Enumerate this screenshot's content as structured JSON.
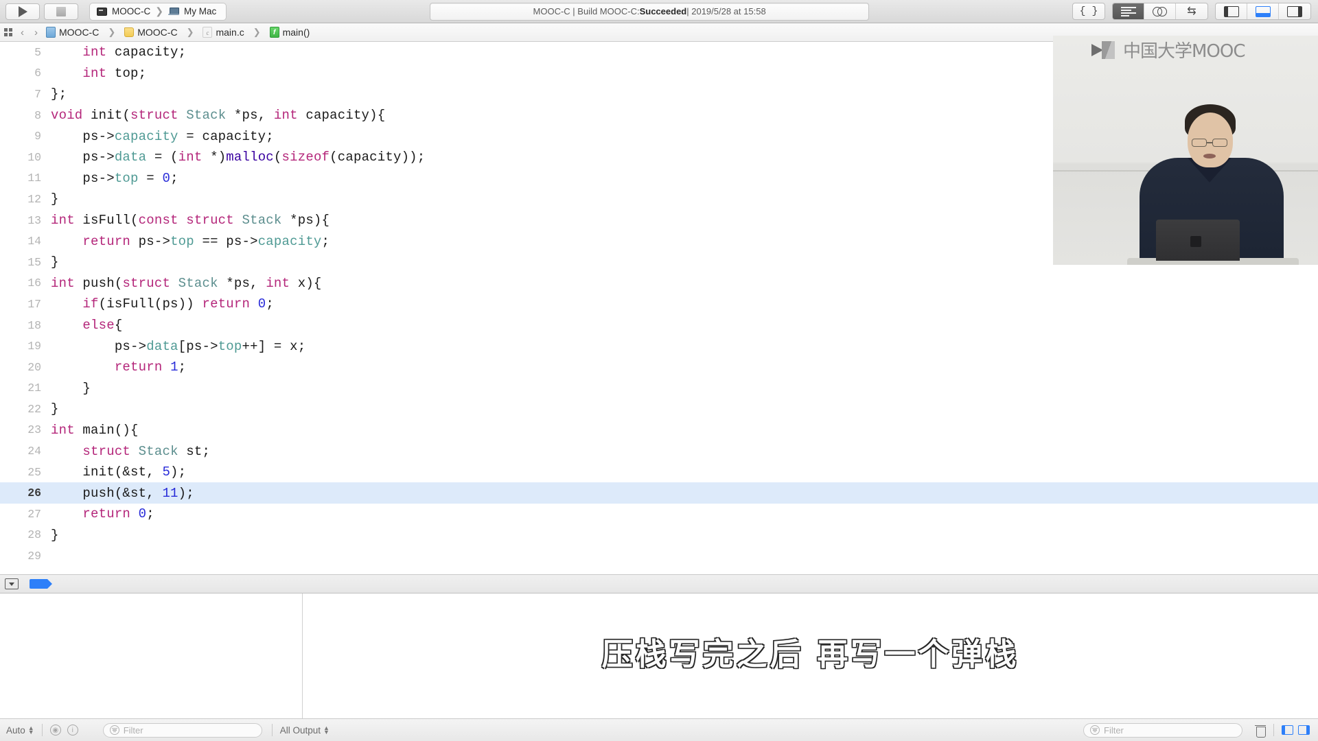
{
  "toolbar": {
    "run_button_label": "Run",
    "stop_button_label": "Stop",
    "scheme": {
      "target": "MOOC-C",
      "destination": "My Mac"
    },
    "status_prefix": "MOOC-C | Build MOOC-C: ",
    "status_result": "Succeeded",
    "status_suffix": " | 2019/5/28 at 15:58",
    "editor_modes": [
      "standard-editor",
      "assistant-editor",
      "version-editor"
    ],
    "braces_label": "{ }",
    "panel_toggles": [
      "navigator-toggle",
      "debug-area-toggle",
      "utilities-toggle"
    ]
  },
  "jumpbar": {
    "grid_label": "related-items",
    "back_label": "‹",
    "forward_label": "›",
    "crumbs": [
      {
        "icon": "project-icon",
        "label": "MOOC-C"
      },
      {
        "icon": "folder-icon",
        "label": "MOOC-C"
      },
      {
        "icon": "c-file-icon",
        "label": "main.c",
        "glyph": "c"
      },
      {
        "icon": "function-icon",
        "label": "main()",
        "glyph": "f"
      }
    ]
  },
  "editor": {
    "first_visible_line": 5,
    "current_line": 26,
    "language": "C",
    "lines": [
      {
        "n": 5,
        "tokens": [
          {
            "t": "    ",
            "c": "pl"
          },
          {
            "t": "int",
            "c": "kw"
          },
          {
            "t": " capacity;",
            "c": "pl"
          }
        ]
      },
      {
        "n": 6,
        "tokens": [
          {
            "t": "    ",
            "c": "pl"
          },
          {
            "t": "int",
            "c": "kw"
          },
          {
            "t": " top;",
            "c": "pl"
          }
        ]
      },
      {
        "n": 7,
        "tokens": [
          {
            "t": "};",
            "c": "pl"
          }
        ]
      },
      {
        "n": 8,
        "tokens": [
          {
            "t": "void",
            "c": "kw"
          },
          {
            "t": " init(",
            "c": "pl"
          },
          {
            "t": "struct",
            "c": "kw"
          },
          {
            "t": " ",
            "c": "pl"
          },
          {
            "t": "Stack",
            "c": "typ"
          },
          {
            "t": " *ps, ",
            "c": "pl"
          },
          {
            "t": "int",
            "c": "kw"
          },
          {
            "t": " capacity){",
            "c": "pl"
          }
        ]
      },
      {
        "n": 9,
        "tokens": [
          {
            "t": "    ps->",
            "c": "pl"
          },
          {
            "t": "capacity",
            "c": "mem"
          },
          {
            "t": " = capacity;",
            "c": "pl"
          }
        ]
      },
      {
        "n": 10,
        "tokens": [
          {
            "t": "    ps->",
            "c": "pl"
          },
          {
            "t": "data",
            "c": "mem"
          },
          {
            "t": " = (",
            "c": "pl"
          },
          {
            "t": "int",
            "c": "kw"
          },
          {
            "t": " *)",
            "c": "pl"
          },
          {
            "t": "malloc",
            "c": "fn"
          },
          {
            "t": "(",
            "c": "pl"
          },
          {
            "t": "sizeof",
            "c": "kw"
          },
          {
            "t": "(capacity));",
            "c": "pl"
          }
        ]
      },
      {
        "n": 11,
        "tokens": [
          {
            "t": "    ps->",
            "c": "pl"
          },
          {
            "t": "top",
            "c": "mem"
          },
          {
            "t": " = ",
            "c": "pl"
          },
          {
            "t": "0",
            "c": "num"
          },
          {
            "t": ";",
            "c": "pl"
          }
        ]
      },
      {
        "n": 12,
        "tokens": [
          {
            "t": "}",
            "c": "pl"
          }
        ]
      },
      {
        "n": 13,
        "tokens": [
          {
            "t": "int",
            "c": "kw"
          },
          {
            "t": " isFull(",
            "c": "pl"
          },
          {
            "t": "const",
            "c": "kw"
          },
          {
            "t": " ",
            "c": "pl"
          },
          {
            "t": "struct",
            "c": "kw"
          },
          {
            "t": " ",
            "c": "pl"
          },
          {
            "t": "Stack",
            "c": "typ"
          },
          {
            "t": " *ps){",
            "c": "pl"
          }
        ]
      },
      {
        "n": 14,
        "tokens": [
          {
            "t": "    ",
            "c": "pl"
          },
          {
            "t": "return",
            "c": "kw"
          },
          {
            "t": " ps->",
            "c": "pl"
          },
          {
            "t": "top",
            "c": "mem"
          },
          {
            "t": " == ps->",
            "c": "pl"
          },
          {
            "t": "capacity",
            "c": "mem"
          },
          {
            "t": ";",
            "c": "pl"
          }
        ]
      },
      {
        "n": 15,
        "tokens": [
          {
            "t": "}",
            "c": "pl"
          }
        ]
      },
      {
        "n": 16,
        "tokens": [
          {
            "t": "int",
            "c": "kw"
          },
          {
            "t": " push(",
            "c": "pl"
          },
          {
            "t": "struct",
            "c": "kw"
          },
          {
            "t": " ",
            "c": "pl"
          },
          {
            "t": "Stack",
            "c": "typ"
          },
          {
            "t": " *ps, ",
            "c": "pl"
          },
          {
            "t": "int",
            "c": "kw"
          },
          {
            "t": " x){",
            "c": "pl"
          }
        ]
      },
      {
        "n": 17,
        "tokens": [
          {
            "t": "    ",
            "c": "pl"
          },
          {
            "t": "if",
            "c": "kw"
          },
          {
            "t": "(isFull(ps)) ",
            "c": "pl"
          },
          {
            "t": "return",
            "c": "kw"
          },
          {
            "t": " ",
            "c": "pl"
          },
          {
            "t": "0",
            "c": "num"
          },
          {
            "t": ";",
            "c": "pl"
          }
        ]
      },
      {
        "n": 18,
        "tokens": [
          {
            "t": "    ",
            "c": "pl"
          },
          {
            "t": "else",
            "c": "kw"
          },
          {
            "t": "{",
            "c": "pl"
          }
        ]
      },
      {
        "n": 19,
        "tokens": [
          {
            "t": "        ps->",
            "c": "pl"
          },
          {
            "t": "data",
            "c": "mem"
          },
          {
            "t": "[ps->",
            "c": "pl"
          },
          {
            "t": "top",
            "c": "mem"
          },
          {
            "t": "++] = x;",
            "c": "pl"
          }
        ]
      },
      {
        "n": 20,
        "tokens": [
          {
            "t": "        ",
            "c": "pl"
          },
          {
            "t": "return",
            "c": "kw"
          },
          {
            "t": " ",
            "c": "pl"
          },
          {
            "t": "1",
            "c": "num"
          },
          {
            "t": ";",
            "c": "pl"
          }
        ]
      },
      {
        "n": 21,
        "tokens": [
          {
            "t": "    }",
            "c": "pl"
          }
        ]
      },
      {
        "n": 22,
        "tokens": [
          {
            "t": "}",
            "c": "pl"
          }
        ]
      },
      {
        "n": 23,
        "tokens": [
          {
            "t": "int",
            "c": "kw"
          },
          {
            "t": " main(){",
            "c": "pl"
          }
        ]
      },
      {
        "n": 24,
        "tokens": [
          {
            "t": "    ",
            "c": "pl"
          },
          {
            "t": "struct",
            "c": "kw"
          },
          {
            "t": " ",
            "c": "pl"
          },
          {
            "t": "Stack",
            "c": "typ"
          },
          {
            "t": " st;",
            "c": "pl"
          }
        ]
      },
      {
        "n": 25,
        "tokens": [
          {
            "t": "    init(&st, ",
            "c": "pl"
          },
          {
            "t": "5",
            "c": "num"
          },
          {
            "t": ");",
            "c": "pl"
          }
        ]
      },
      {
        "n": 26,
        "tokens": [
          {
            "t": "    push(&st, ",
            "c": "pl"
          },
          {
            "t": "11",
            "c": "num"
          },
          {
            "t": ");",
            "c": "pl"
          }
        ]
      },
      {
        "n": 27,
        "tokens": [
          {
            "t": "    ",
            "c": "pl"
          },
          {
            "t": "return",
            "c": "kw"
          },
          {
            "t": " ",
            "c": "pl"
          },
          {
            "t": "0",
            "c": "num"
          },
          {
            "t": ";",
            "c": "pl"
          }
        ]
      },
      {
        "n": 28,
        "tokens": [
          {
            "t": "}",
            "c": "pl"
          }
        ]
      },
      {
        "n": 29,
        "tokens": [
          {
            "t": "",
            "c": "pl"
          }
        ]
      }
    ]
  },
  "debugbar": {
    "hide_label": "hide-debug-area",
    "breakpoints_label": "breakpoints-toggle"
  },
  "console": {
    "subtitle": "压栈写完之后 再写一个弹栈"
  },
  "bottombar": {
    "auto_label": "Auto",
    "variables_filter_placeholder": "Filter",
    "output_scope": "All Output",
    "console_filter_placeholder": "Filter",
    "clear_label": "clear-console"
  },
  "video": {
    "logo_text": "中国大学MOOC"
  },
  "colors": {
    "keyword": "#b4267a",
    "type": "#5c8e8e",
    "member": "#4f9a94",
    "number": "#272ad8",
    "function": "#3900a0",
    "current_line_bg": "#ddeafa",
    "accent_blue": "#2d7ff9"
  }
}
